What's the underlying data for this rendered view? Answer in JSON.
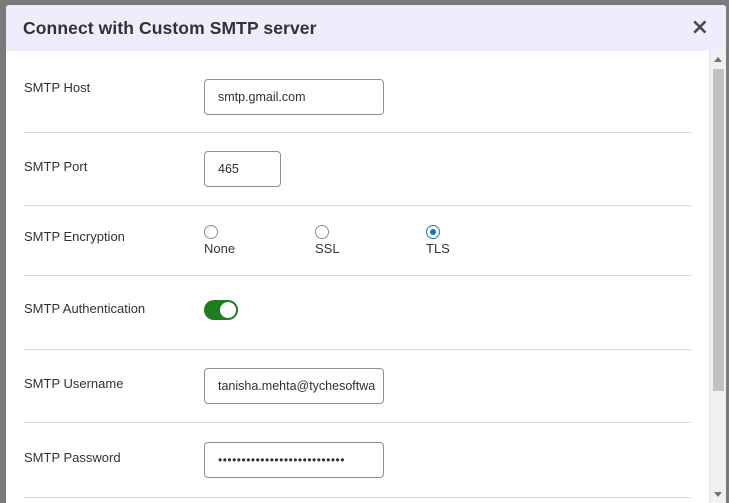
{
  "modal": {
    "title": "Connect with Custom SMTP server",
    "close_glyph": "×"
  },
  "fields": {
    "host": {
      "label": "SMTP Host",
      "value": "smtp.gmail.com"
    },
    "port": {
      "label": "SMTP Port",
      "value": "465"
    },
    "encryption": {
      "label": "SMTP Encryption",
      "options": [
        {
          "label": "None",
          "checked": false
        },
        {
          "label": "SSL",
          "checked": false
        },
        {
          "label": "TLS",
          "checked": true
        }
      ]
    },
    "authentication": {
      "label": "SMTP Authentication",
      "enabled": true
    },
    "username": {
      "label": "SMTP Username",
      "value": "tanisha.mehta@tychesoftwa"
    },
    "password": {
      "label": "SMTP Password",
      "value": "•••••••••••••••••••••••••••"
    }
  },
  "colors": {
    "header_bg": "#efecfb",
    "toggle_on": "#1e7e1e",
    "radio_checked": "#2271b1"
  },
  "icons": {
    "close": "close-icon",
    "scroll_up": "chevron-up-icon",
    "scroll_down": "chevron-down-icon"
  }
}
